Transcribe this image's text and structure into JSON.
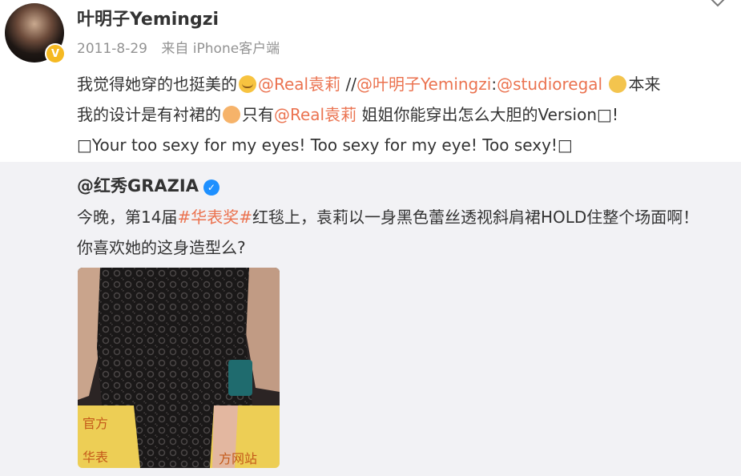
{
  "post": {
    "username": "叶明子Yemingzi",
    "date": "2011-8-29",
    "source": "来自 iPhone客户端",
    "verified_badge": "V",
    "text_parts": {
      "p1": "我觉得她穿的也挺美的",
      "m1": "@Real袁莉",
      "p2": " //",
      "m2": "@叶明子Yemingzi",
      "p3": ":",
      "m3": "@studioregal",
      "p4": "本来",
      "p5": "我的设计是有衬裙的",
      "p6": "只有",
      "m4": "@Real袁莉",
      "p7": " 姐姐你能穿出怎么大胆的Version",
      "p8": "!",
      "p9": "Your too sexy for my eyes! Too sexy for my eye! Too sexy!"
    }
  },
  "repost": {
    "username": "@红秀GRAZIA",
    "verified_badge": "✓",
    "text_parts": {
      "t1": "今晚，第14届",
      "tag": "#华表奖#",
      "t2": "红毯上，袁莉以一身黑色蕾丝透视斜肩裙HOLD住整个场面啊！",
      "t3": "你喜欢她的这身造型么?"
    },
    "image_watermark": "官方 华表 方网站"
  },
  "colors": {
    "accent": "#eb7350",
    "meta": "#939393",
    "repost_bg": "#f2f2f5",
    "verified_blue": "#1e90ff",
    "avatar_badge": "#f5b922"
  },
  "icons": [
    "chevron-down-icon",
    "avatar-verified-icon",
    "verified-blue-icon",
    "emoji-icon"
  ]
}
